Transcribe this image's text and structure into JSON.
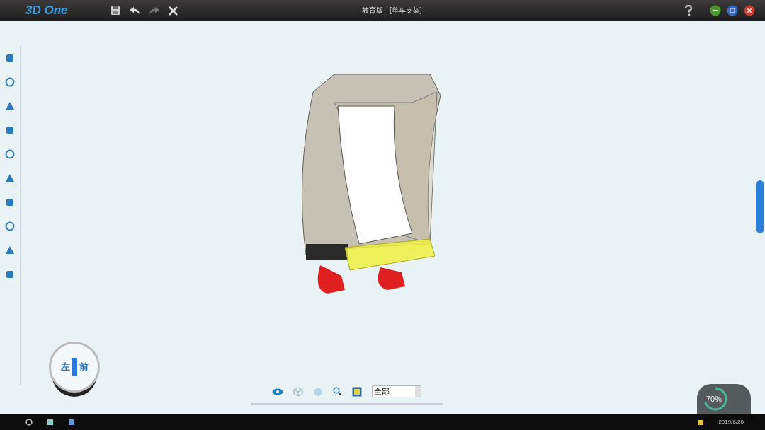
{
  "app": {
    "logo": "3D One",
    "title": "教育版 - [单车支架]"
  },
  "view_cube": {
    "left_face": "左",
    "front_face": "前"
  },
  "view_toolbar": {
    "filter": {
      "value": "全部"
    }
  },
  "gauge": {
    "reading": "70%",
    "level": 0.7
  },
  "taskbar": {
    "date": "2019/6/20"
  }
}
